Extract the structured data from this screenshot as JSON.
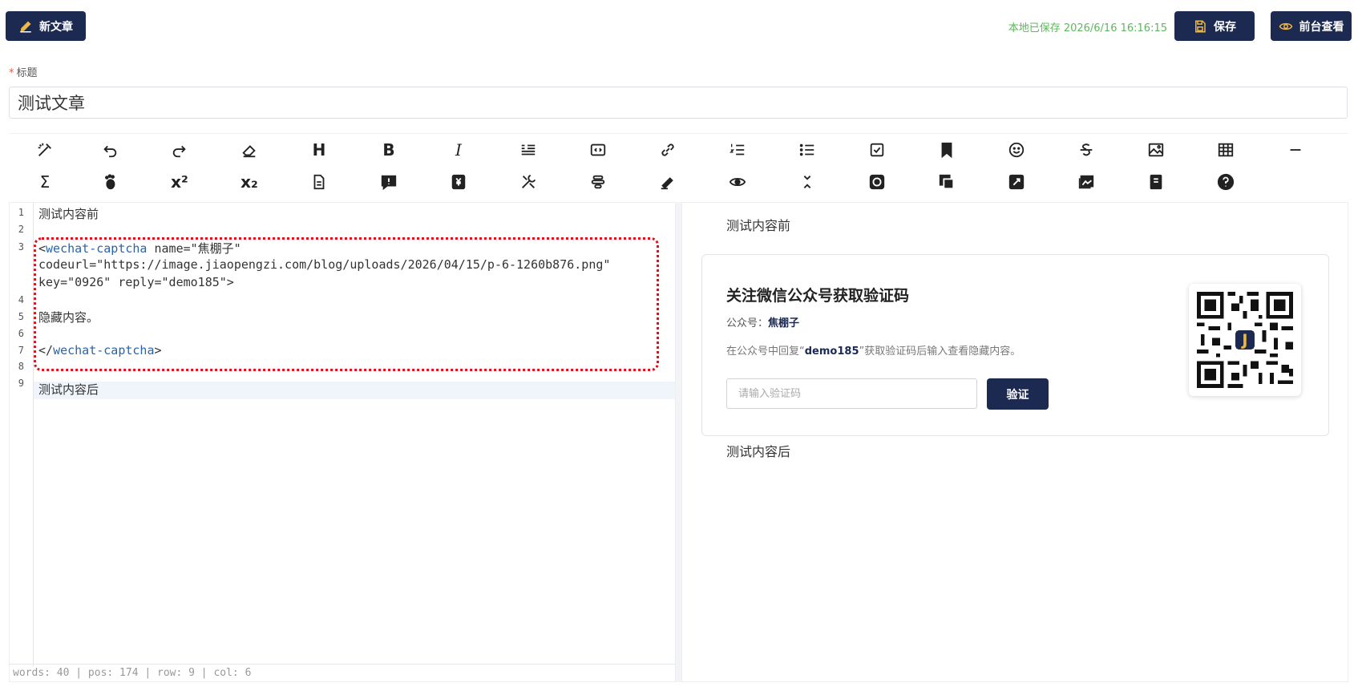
{
  "header": {
    "new_article_label": "新文章",
    "saved_status": "本地已保存 2026/6/16 16:16:15",
    "save_label": "保存",
    "view_front_label": "前台查看"
  },
  "title_field": {
    "required_mark": "*",
    "label": "标题",
    "value": "测试文章"
  },
  "toolbar": {
    "row1_icons": [
      "magic-pen-icon",
      "undo-icon",
      "redo-icon",
      "eraser-icon",
      "heading-icon",
      "bold-icon",
      "italic-icon",
      "quote-icon",
      "code-block-icon",
      "link-icon",
      "ordered-list-icon",
      "unordered-list-icon",
      "checklist-icon",
      "bookmark-icon",
      "emoji-icon",
      "strikethrough-icon",
      "image-icon",
      "table-icon",
      "horizontal-rule-icon"
    ],
    "row2_icons": [
      "formula-icon",
      "footnote-icon",
      "superscript-icon",
      "subscript-icon",
      "document-icon",
      "alert-icon",
      "currency-icon",
      "tools-icon",
      "align-icon",
      "highlighter-icon",
      "preview-icon",
      "collapse-icon",
      "refresh-icon",
      "copy-icon",
      "fullscreen-icon",
      "gallery-icon",
      "notebook-icon",
      "help-icon"
    ],
    "labels": {
      "heading": "H",
      "bold": "B",
      "italic": "I",
      "sum": "Σ",
      "superscript": "x²",
      "subscript": "x₂",
      "help": "?"
    }
  },
  "editor": {
    "line_numbers": [
      "1",
      "2",
      "3",
      "4",
      "5",
      "6",
      "7",
      "8",
      "9"
    ],
    "lines": {
      "l1": "测试内容前",
      "l3a_open": "<",
      "l3a_tag": "wechat-captcha",
      "l3a_rest": " name=\"焦棚子\"",
      "l3b": "codeurl=\"https://image.jiaopengzi.com/blog/uploads/2026/04/15/p-6-1260b876.png\"",
      "l3c": "key=\"0926\" reply=\"demo185\">",
      "l5": "隐藏内容。",
      "l7_open": "</",
      "l7_tag": "wechat-captcha",
      "l7_close": ">",
      "l9": "测试内容后"
    },
    "status_bar": "words: 40 | pos: 174 | row: 9 | col: 6"
  },
  "preview": {
    "before_text": "测试内容前",
    "after_text": "测试内容后",
    "card": {
      "title": "关注微信公众号获取验证码",
      "account_label": "公众号：",
      "account_name": "焦棚子",
      "hint_prefix": "在公众号中回复“",
      "hint_keyword": "demo185",
      "hint_suffix": "”获取验证码后输入查看隐藏内容。",
      "input_placeholder": "请输入验证码",
      "verify_label": "验证",
      "qr_logo_letter": "J"
    }
  },
  "colors": {
    "accent": "#1c2951",
    "saved_green": "#5cb85c",
    "tag_blue": "#2b63a7",
    "highlight_red": "#e0101c"
  }
}
